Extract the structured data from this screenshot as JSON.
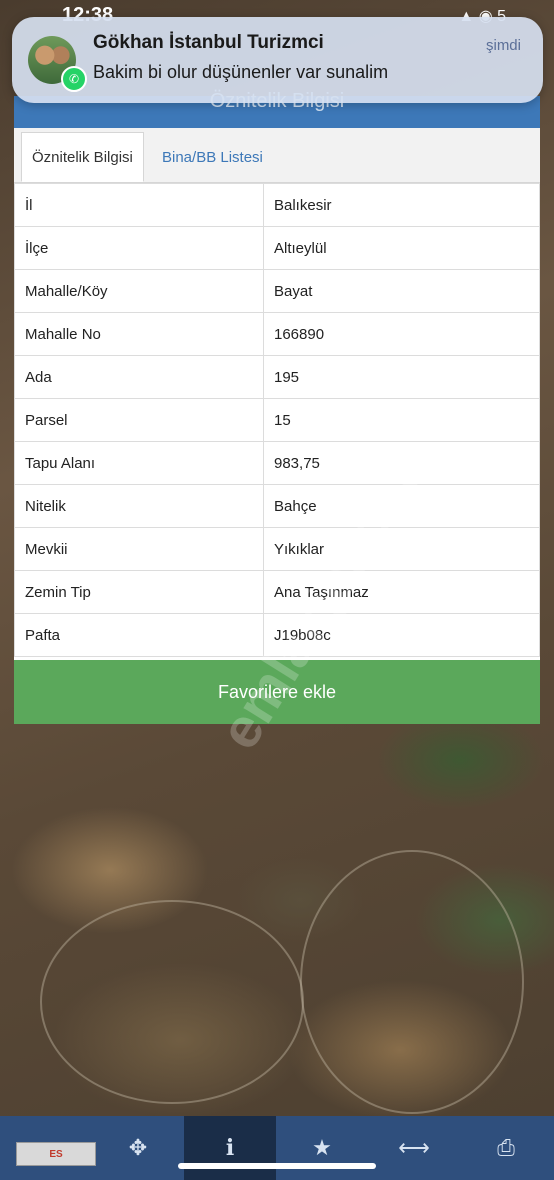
{
  "status_bar": {
    "time": "12:38",
    "icons": "▲ ◉ 5"
  },
  "notification": {
    "app_icon": "whatsapp-icon",
    "title": "Gökhan İstanbul Turizmci",
    "body": "Bakim bi olur düşünenler var sunalim",
    "time": "şimdi"
  },
  "panel": {
    "title": "Öznitelik Bilgisi",
    "tabs": [
      {
        "label": "Öznitelik Bilgisi",
        "active": true
      },
      {
        "label": "Bina/BB Listesi",
        "active": false
      }
    ],
    "rows": [
      {
        "key": "İl",
        "value": "Balıkesir"
      },
      {
        "key": "İlçe",
        "value": "Altıeylül"
      },
      {
        "key": "Mahalle/Köy",
        "value": "Bayat"
      },
      {
        "key": "Mahalle No",
        "value": "166890"
      },
      {
        "key": "Ada",
        "value": "195"
      },
      {
        "key": "Parsel",
        "value": "15"
      },
      {
        "key": "Tapu Alanı",
        "value": "983,75"
      },
      {
        "key": "Nitelik",
        "value": "Bahçe"
      },
      {
        "key": "Mevkii",
        "value": "Yıkıklar"
      },
      {
        "key": "Zemin Tip",
        "value": "Ana Taşınmaz"
      },
      {
        "key": "Pafta",
        "value": "J19b08c"
      }
    ],
    "favorite_button": "Favorilere ekle"
  },
  "watermark": "emlakjet.com",
  "toolbar": {
    "logo_text": "ES",
    "items": [
      {
        "name": "locate-icon",
        "glyph": "✥"
      },
      {
        "name": "info-icon",
        "glyph": "i"
      },
      {
        "name": "star-icon",
        "glyph": "★"
      },
      {
        "name": "measure-icon",
        "glyph": "⟷"
      },
      {
        "name": "print-icon",
        "glyph": "⎙"
      }
    ]
  },
  "colors": {
    "header": "#3d78b8",
    "button": "#5ba85b",
    "toolbar": "#2f4f7d"
  }
}
